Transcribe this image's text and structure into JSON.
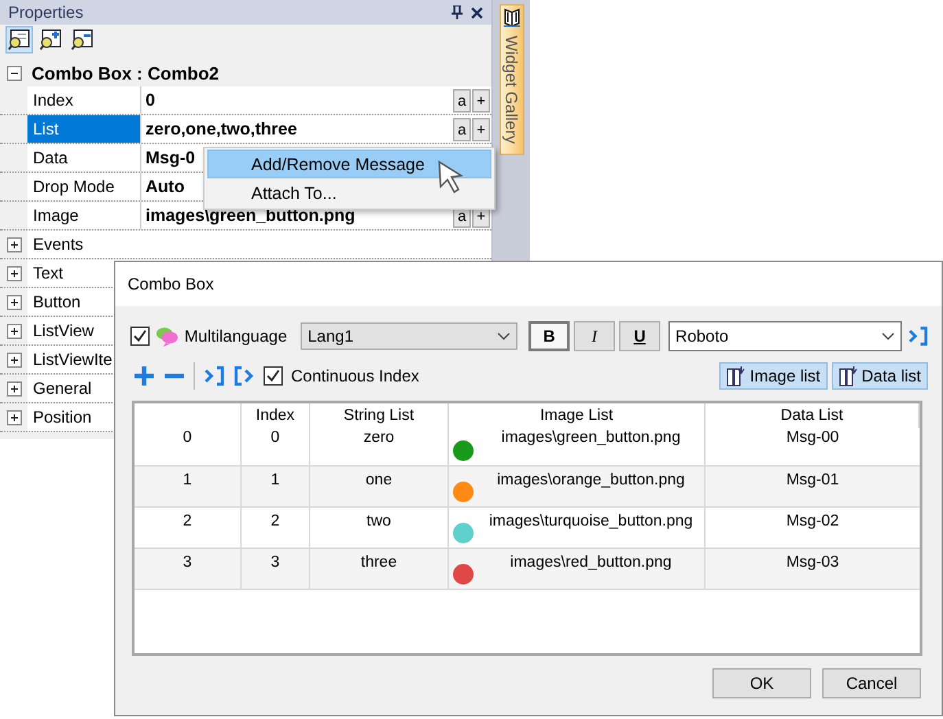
{
  "properties": {
    "title": "Properties",
    "tools": [
      {
        "selected": true
      },
      {
        "selected": false
      },
      {
        "selected": false
      }
    ],
    "category": {
      "label": "Combo Box : Combo2",
      "expanded": true
    },
    "rows": [
      {
        "name": "Index",
        "value": "0",
        "selected": false,
        "buttons": [
          "a",
          "+"
        ]
      },
      {
        "name": "List",
        "value": "zero,one,two,three",
        "selected": true,
        "buttons": [
          "a",
          "+"
        ]
      },
      {
        "name": "Data",
        "value": "Msg-0",
        "selected": false
      },
      {
        "name": "Drop Mode",
        "value": "Auto",
        "selected": false
      },
      {
        "name": "Image",
        "value": "images\\green_button.png",
        "selected": false,
        "buttons": [
          "a",
          "+"
        ]
      }
    ],
    "groups": [
      {
        "label": "Events",
        "expanded": false
      },
      {
        "label": "Text",
        "expanded": false
      },
      {
        "label": "Button",
        "expanded": false
      },
      {
        "label": "ListView",
        "expanded": false
      },
      {
        "label": "ListViewIte",
        "expanded": false
      },
      {
        "label": "General",
        "expanded": false
      },
      {
        "label": "Position",
        "expanded": false
      }
    ]
  },
  "widget_gallery": {
    "label": "Widget Gallery"
  },
  "context_menu": {
    "items": [
      {
        "label": "Add/Remove Message",
        "selected": true
      },
      {
        "label": "Attach To...",
        "selected": false
      }
    ]
  },
  "dialog": {
    "title": "Combo Box",
    "multilanguage": {
      "label": "Multilanguage",
      "checked": true
    },
    "language": "Lang1",
    "styles": [
      {
        "label": "B",
        "kind": "bold",
        "selected": true
      },
      {
        "label": "I",
        "kind": "italic",
        "selected": false
      },
      {
        "label": "U",
        "kind": "underline",
        "selected": false
      }
    ],
    "font": "Roboto",
    "continuous_index": {
      "label": "Continuous Index",
      "checked": true
    },
    "toggles": [
      {
        "label": "Image list",
        "selected": true
      },
      {
        "label": "Data list",
        "selected": true
      }
    ],
    "table": {
      "columns": [
        "Index",
        "String List",
        "Image List",
        "Data List"
      ],
      "rows": [
        {
          "row": "0",
          "index": "0",
          "string": "zero",
          "image": "images\\green_button.png",
          "color": "#1a9a1a",
          "data": "Msg-00"
        },
        {
          "row": "1",
          "index": "1",
          "string": "one",
          "image": "images\\orange_button.png",
          "color": "#ff8a14",
          "data": "Msg-01"
        },
        {
          "row": "2",
          "index": "2",
          "string": "two",
          "image": "images\\turquoise_button.png",
          "color": "#5fd0cc",
          "data": "Msg-02"
        },
        {
          "row": "3",
          "index": "3",
          "string": "three",
          "image": "images\\red_button.png",
          "color": "#e04848",
          "data": "Msg-03"
        }
      ]
    },
    "buttons": [
      "OK",
      "Cancel"
    ]
  }
}
